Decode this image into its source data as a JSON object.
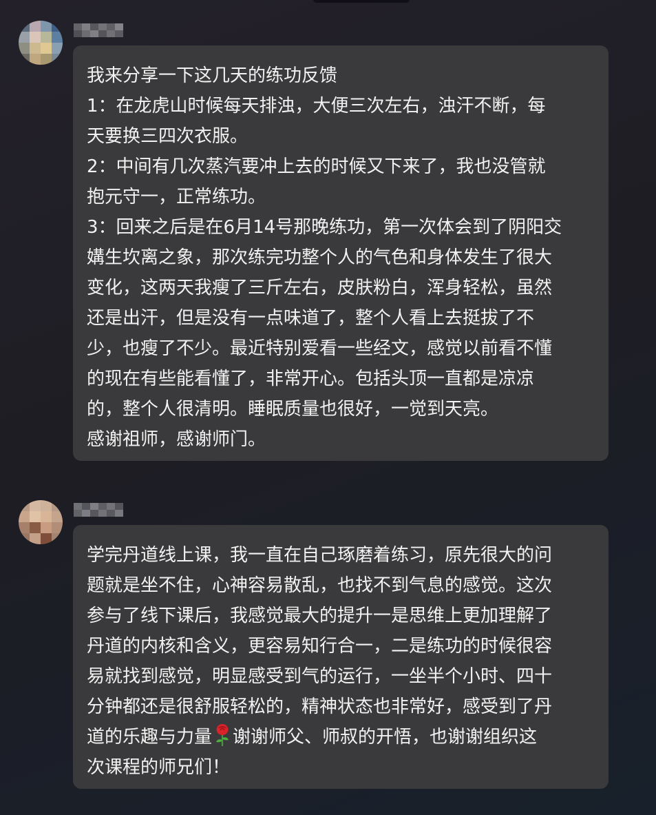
{
  "chat": {
    "messages": [
      {
        "sender_name": "",
        "lines": [
          "我来分享一下这几天的练功反馈",
          "1：在龙虎山时候每天排浊，大便三次左右，浊汗不断，每",
          "天要换三四次衣服。",
          "2：中间有几次蒸汽要冲上去的时候又下来了，我也没管就",
          "抱元守一，正常练功。",
          "3：回来之后是在6月14号那晚练功，第一次体会到了阴阳交",
          "媾生坎离之象，那次练完功整个人的气色和身体发生了很大",
          "变化，这两天我瘦了三斤左右，皮肤粉白，浑身轻松，虽然",
          "还是出汗，但是没有一点味道了，整个人看上去挺拔了不",
          "少，也瘦了不少。最近特别爱看一些经文，感觉以前看不懂",
          "的现在有些能看懂了，非常开心。包括头顶一直都是凉凉",
          "的，整个人很清明。睡眠质量也很好，一觉到天亮。",
          "感谢祖师，感谢师门。"
        ]
      },
      {
        "sender_name": "",
        "lines": [
          "学完丹道线上课，我一直在自己琢磨着练习，原先很大的问",
          "题就是坐不住，心神容易散乱，也找不到气息的感觉。这次",
          "参与了线下课后，我感觉最大的提升一是思维上更加理解了",
          "丹道的内核和含义，更容易知行合一，二是练功的时候很容",
          "易就找到感觉，明显感受到气的运行，一坐半个小时、四十",
          "分钟都还是很舒服轻松的，精神状态也非常好，感受到了丹"
        ],
        "emoji_line_before": "道的乐趣与力量",
        "emoji": "rose-emoji",
        "emoji_line_after": "谢谢师父、师叔的开悟，也谢谢组织这",
        "last_line": "次课程的师兄们！"
      }
    ],
    "colors": {
      "bubble": "#3a3a3c",
      "text": "#f2f2f2"
    }
  }
}
